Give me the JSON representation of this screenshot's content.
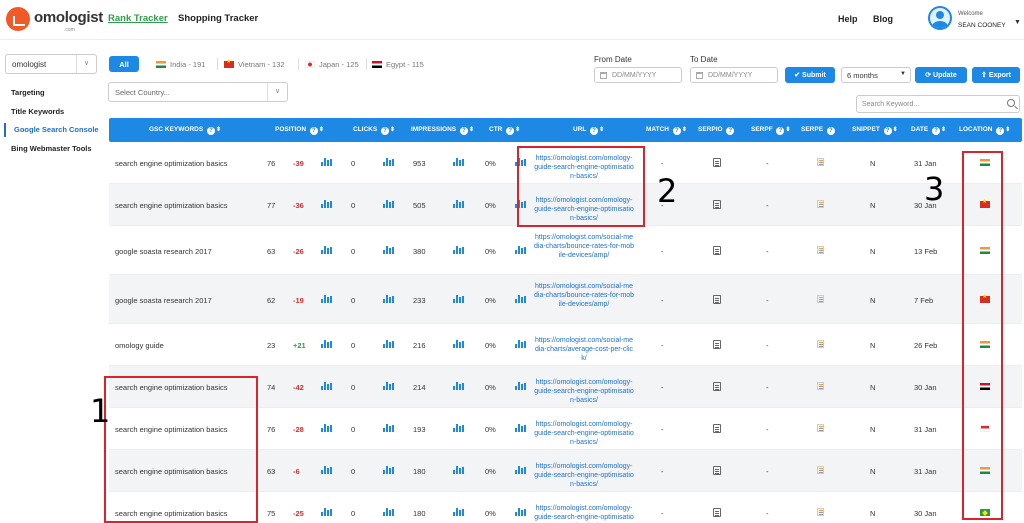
{
  "brand": {
    "name": "omologist",
    "sub": ".com"
  },
  "nav": {
    "tabs": [
      "Rank Tracker",
      "Shopping Tracker"
    ],
    "help": "Help",
    "blog": "Blog"
  },
  "user": {
    "welcome": "Welcome",
    "name": "SEAN COONEY"
  },
  "sidebar": {
    "site": "omologist",
    "items": [
      "Targeting",
      "Title Keywords",
      "Google Search Console",
      "Bing Webmaster Tools"
    ],
    "active_index": 2
  },
  "filters": {
    "all_label": "All",
    "countries": [
      {
        "label": "India - 191",
        "flag": "in"
      },
      {
        "label": "Vietnam - 132",
        "flag": "vn"
      },
      {
        "label": "Japan - 125",
        "flag": "jp"
      },
      {
        "label": "Egypt - 115",
        "flag": "eg"
      }
    ],
    "country_placeholder": "Select Country...",
    "from_label": "From Date",
    "to_label": "To Date",
    "date_placeholder": "DD/MM/YYYY",
    "submit": "Submit",
    "period": "6 months",
    "update": "Update",
    "export": "Export",
    "search_placeholder": "Search Keyword..."
  },
  "table": {
    "headers": [
      "GSC KEYWORDS",
      "POSITION",
      "CLICKS",
      "IMPRESSIONS",
      "CTR",
      "URL",
      "MATCH",
      "SERPIO",
      "SERPF",
      "SERPE",
      "SNIPPET",
      "DATE",
      "LOCATION"
    ],
    "rows": [
      {
        "keyword": "search engine optimization basics",
        "position": "76",
        "change": "-39",
        "clicks": "0",
        "impressions": "953",
        "ctr": "0%",
        "url": "https://omologist.com/omology-guide-search-engine-optimisation-basics/",
        "match": "-",
        "serpf": "-",
        "snippet": "N",
        "date": "31 Jan",
        "flag": "in"
      },
      {
        "keyword": "search engine optimization basics",
        "position": "77",
        "change": "-36",
        "clicks": "0",
        "impressions": "505",
        "ctr": "0%",
        "url": "https://omologist.com/omology-guide-search-engine-optimisation-basics/",
        "match": "-",
        "serpf": "-",
        "snippet": "N",
        "date": "30 Jan",
        "flag": "vn"
      },
      {
        "keyword": "google soasta research 2017",
        "position": "63",
        "change": "-26",
        "clicks": "0",
        "impressions": "380",
        "ctr": "0%",
        "url": "https://omologist.com/social-media-charts/bounce-rates-for-mobile-devices/amp/",
        "match": "-",
        "serpf": "-",
        "snippet": "N",
        "date": "13 Feb",
        "flag": "in"
      },
      {
        "keyword": "google soasta research 2017",
        "position": "62",
        "change": "-19",
        "clicks": "0",
        "impressions": "233",
        "ctr": "0%",
        "url": "https://omologist.com/social-media-charts/bounce-rates-for-mobile-devices/amp/",
        "match": "-",
        "serpf": "-",
        "snippet": "N",
        "date": "7 Feb",
        "flag": "vn"
      },
      {
        "keyword": "omology guide",
        "position": "23",
        "change": "+21",
        "clicks": "0",
        "impressions": "216",
        "ctr": "0%",
        "url": "https://omologist.com/social-media-charts/average-cost-per-click/",
        "match": "-",
        "serpf": "-",
        "snippet": "N",
        "date": "26 Feb",
        "flag": "in"
      },
      {
        "keyword": "search engine optimization basics",
        "position": "74",
        "change": "-42",
        "clicks": "0",
        "impressions": "214",
        "ctr": "0%",
        "url": "https://omologist.com/omology-guide-search-engine-optimisation-basics/",
        "match": "-",
        "serpf": "-",
        "snippet": "N",
        "date": "30 Jan",
        "flag": "eg"
      },
      {
        "keyword": "search engine optimization basics",
        "position": "76",
        "change": "-28",
        "clicks": "0",
        "impressions": "193",
        "ctr": "0%",
        "url": "https://omologist.com/omology-guide-search-engine-optimisation-basics/",
        "match": "-",
        "serpf": "-",
        "snippet": "N",
        "date": "31 Jan",
        "flag": "id"
      },
      {
        "keyword": "search engine optimisation basics",
        "position": "63",
        "change": "-6",
        "clicks": "0",
        "impressions": "180",
        "ctr": "0%",
        "url": "https://omologist.com/omology-guide-search-engine-optimisation-basics/",
        "match": "-",
        "serpf": "-",
        "snippet": "N",
        "date": "31 Jan",
        "flag": "in"
      },
      {
        "keyword": "search engine optimization basics",
        "position": "75",
        "change": "-25",
        "clicks": "0",
        "impressions": "180",
        "ctr": "0%",
        "url": "https://omologist.com/omology-guide-search-engine-optimisation-basics/",
        "match": "-",
        "serpf": "-",
        "snippet": "N",
        "date": "30 Jan",
        "flag": "br"
      }
    ]
  },
  "annotations": {
    "n1": "1",
    "n2": "2",
    "n3": "3",
    "color": "#d9232d"
  },
  "colors": {
    "accent": "#1e88e5",
    "active_tab": "#2e9c4a",
    "negative": "#d32f2f",
    "positive": "#2e9c4a"
  }
}
